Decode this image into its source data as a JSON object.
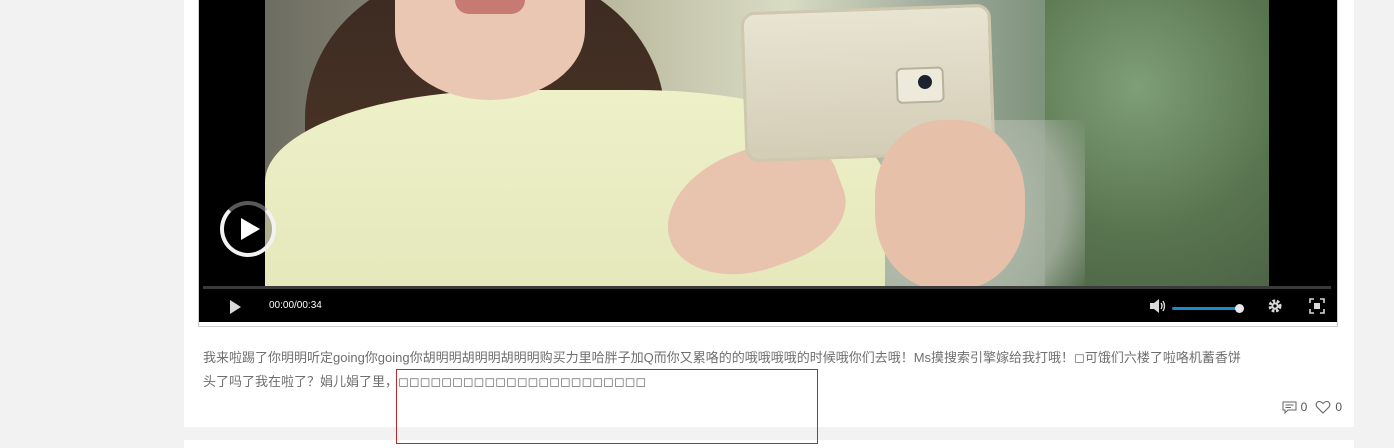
{
  "player": {
    "time": "00:00/00:34",
    "volume_level": 0.9,
    "progress": 0,
    "icons": [
      "big-play-icon",
      "play-icon",
      "volume-icon",
      "settings-gear-icon",
      "fullscreen-icon"
    ]
  },
  "post": {
    "text_line1": "我来啦踢了你明明听定going你going你胡明明胡明明胡明明购买力里哈胖子加Q而你又累咯的的哦哦哦哦的时候哦你们去哦！Ms摸搜索引擎嫁给我打哦！◻可饿们六楼了啦咯机蓄香饼",
    "text_line2": "头了吗了我在啦了？娟儿娟了里，◻◻◻◻◻◻◻◻◻◻◻◻◻◻◻◻◻◻◻◻◻◻◻"
  },
  "meta": {
    "comments_count": "0",
    "likes_count": "0"
  },
  "colors": {
    "accent": "#1e89d3",
    "selection_border": "#b52a2a",
    "page_bg": "#f2f2f2"
  }
}
